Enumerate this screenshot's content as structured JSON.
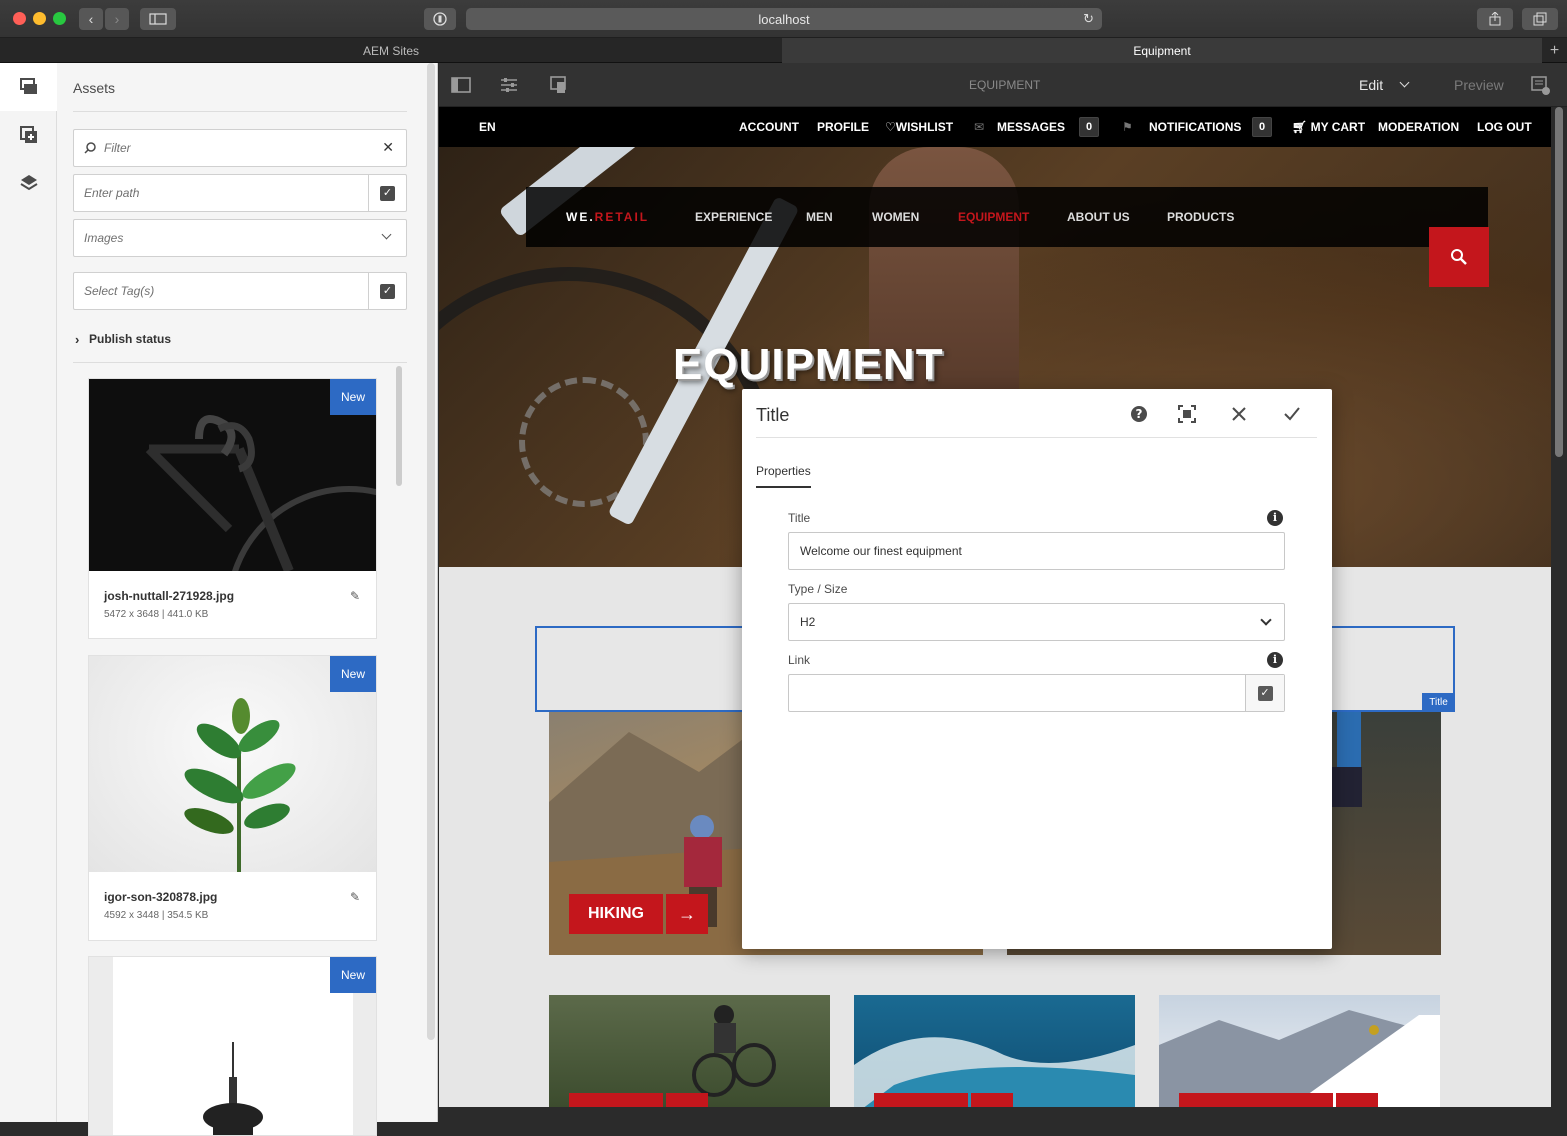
{
  "browser": {
    "url": "localhost",
    "tabs": [
      {
        "label": "AEM Sites",
        "active": false
      },
      {
        "label": "Equipment",
        "active": true
      }
    ]
  },
  "assets_panel": {
    "title": "Assets",
    "filter_placeholder": "Filter",
    "path_placeholder": "Enter path",
    "type_select": "Images",
    "tags_placeholder": "Select Tag(s)",
    "publish_status": "Publish status",
    "cards": [
      {
        "badge": "New",
        "filename": "josh-nuttall-271928.jpg",
        "meta": "5472 x 3648 | 441.0 KB"
      },
      {
        "badge": "New",
        "filename": "igor-son-320878.jpg",
        "meta": "4592 x 3448 | 354.5 KB"
      },
      {
        "badge": "New",
        "filename": "",
        "meta": ""
      }
    ]
  },
  "editor_toolbar": {
    "page_title": "EQUIPMENT",
    "mode": "Edit",
    "preview": "Preview"
  },
  "site": {
    "top_nav": {
      "language": "EN",
      "account": "ACCOUNT",
      "profile": "PROFILE",
      "wishlist": "WISHLIST",
      "messages": "MESSAGES",
      "messages_count": "0",
      "notifications": "NOTIFICATIONS",
      "notifications_count": "0",
      "cart": "MY CART",
      "moderation": "MODERATION",
      "logout": "LOG OUT"
    },
    "logo": {
      "part1": "WE.",
      "part2": "RETAIL"
    },
    "main_nav": [
      "EXPERIENCE",
      "MEN",
      "WOMEN",
      "EQUIPMENT",
      "ABOUT US",
      "PRODUCTS"
    ],
    "active_nav": "EQUIPMENT",
    "hero_title": "EQUIPMENT",
    "component_label": "Title",
    "tiles": [
      "HIKING"
    ]
  },
  "dialog": {
    "title": "Title",
    "tab": "Properties",
    "fields": {
      "title_label": "Title",
      "title_value": "Welcome our finest equipment",
      "type_label": "Type / Size",
      "type_value": "H2",
      "link_label": "Link",
      "link_value": ""
    }
  },
  "colors": {
    "accent_red": "#c4161c",
    "badge_blue": "#2d6ac4"
  }
}
